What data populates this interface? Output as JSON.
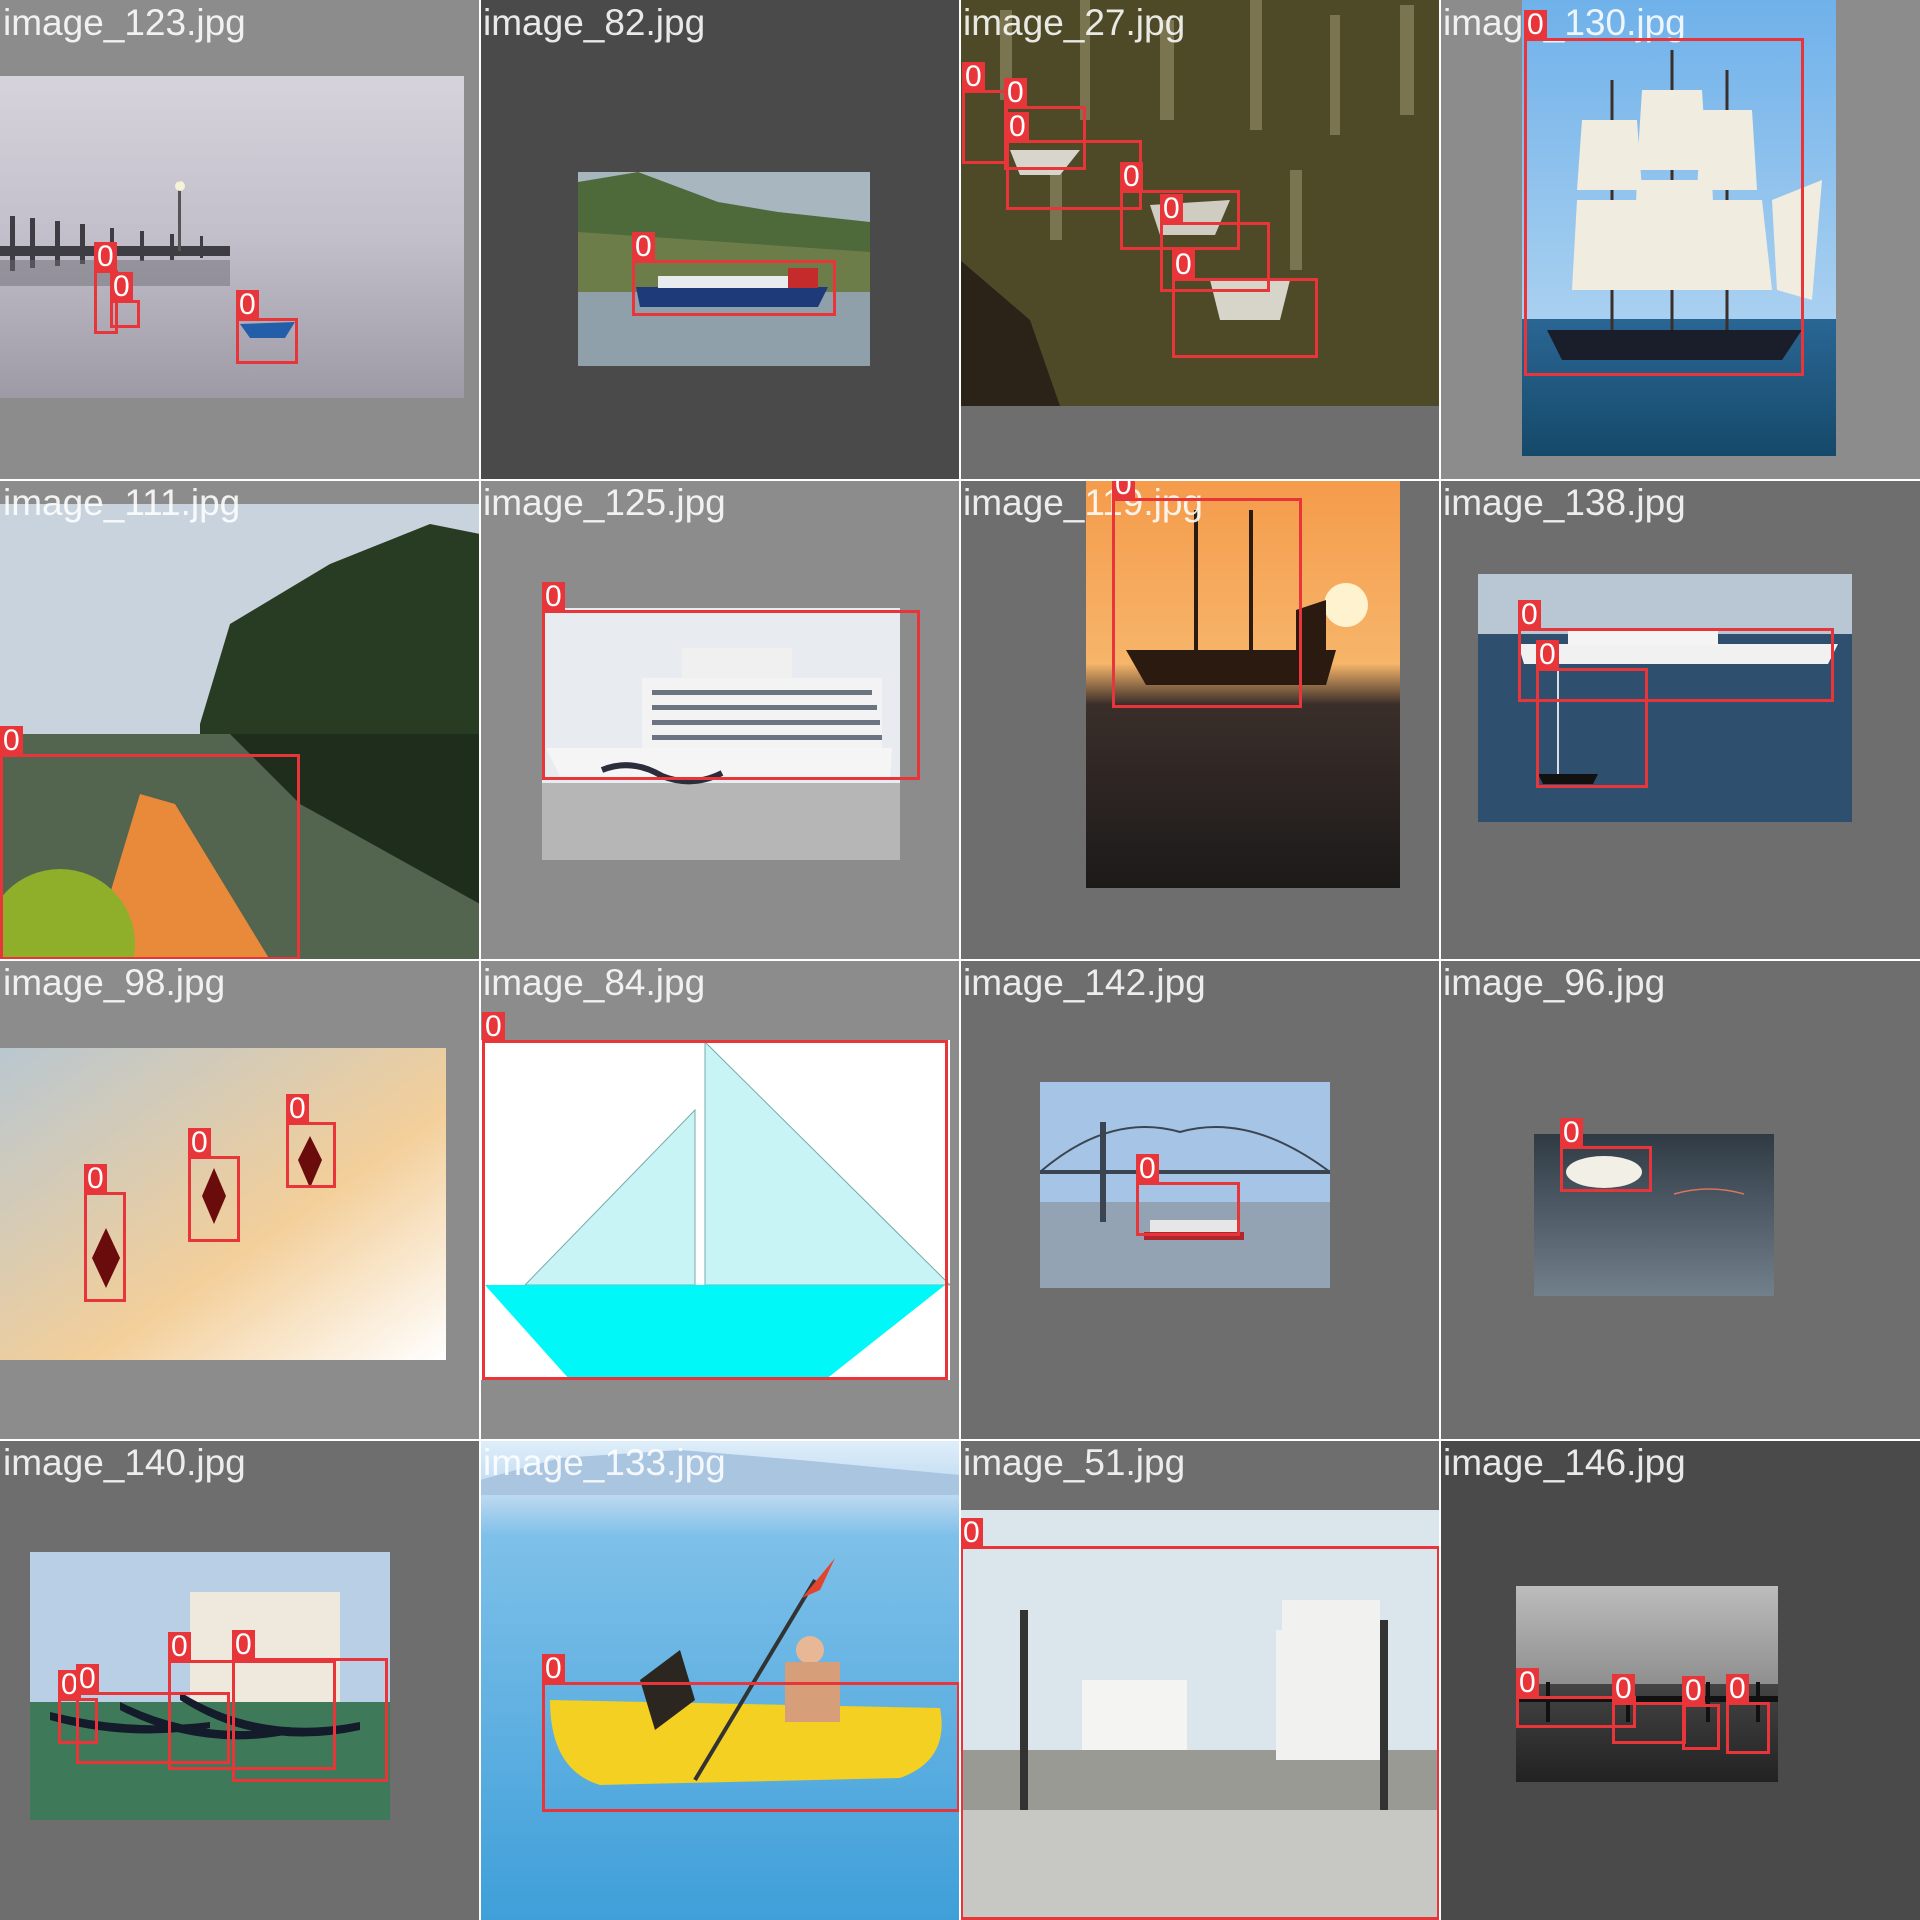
{
  "grid": {
    "columns": 4,
    "rows": 4
  },
  "tiles": [
    {
      "filename": "image_123.jpg",
      "background": "#8c8c8c",
      "labels": [
        "0",
        "0",
        "0"
      ]
    },
    {
      "filename": "image_82.jpg",
      "background": "#4a4a4a",
      "labels": [
        "0"
      ]
    },
    {
      "filename": "image_27.jpg",
      "background": "#6e6e6e",
      "labels": [
        "0",
        "0",
        "0",
        "0",
        "0",
        "0"
      ]
    },
    {
      "filename": "image_130.jpg",
      "background": "#8c8c8c",
      "labels": [
        "0"
      ]
    },
    {
      "filename": "image_111.jpg",
      "background": "#8c8c8c",
      "labels": [
        "0"
      ]
    },
    {
      "filename": "image_125.jpg",
      "background": "#8c8c8c",
      "labels": [
        "0"
      ]
    },
    {
      "filename": "image_119.jpg",
      "background": "#6e6e6e",
      "labels": [
        "0"
      ]
    },
    {
      "filename": "image_138.jpg",
      "background": "#6e6e6e",
      "labels": [
        "0",
        "0"
      ]
    },
    {
      "filename": "image_98.jpg",
      "background": "#8c8c8c",
      "labels": [
        "0",
        "0",
        "0"
      ]
    },
    {
      "filename": "image_84.jpg",
      "background": "#8c8c8c",
      "labels": [
        "0"
      ]
    },
    {
      "filename": "image_142.jpg",
      "background": "#6e6e6e",
      "labels": [
        "0"
      ]
    },
    {
      "filename": "image_96.jpg",
      "background": "#6e6e6e",
      "labels": [
        "0"
      ]
    },
    {
      "filename": "image_140.jpg",
      "background": "#6e6e6e",
      "labels": [
        "0",
        "0",
        "0",
        "0"
      ]
    },
    {
      "filename": "image_133.jpg",
      "background": "#8c8c8c",
      "labels": [
        "0"
      ]
    },
    {
      "filename": "image_51.jpg",
      "background": "#6e6e6e",
      "labels": [
        "0"
      ]
    },
    {
      "filename": "image_146.jpg",
      "background": "#4a4a4a",
      "labels": [
        "0",
        "0",
        "0",
        "0"
      ]
    }
  ],
  "colors": {
    "box": "#e8353a",
    "gutter": "#ffffff",
    "filename_text": "#ffffff"
  }
}
